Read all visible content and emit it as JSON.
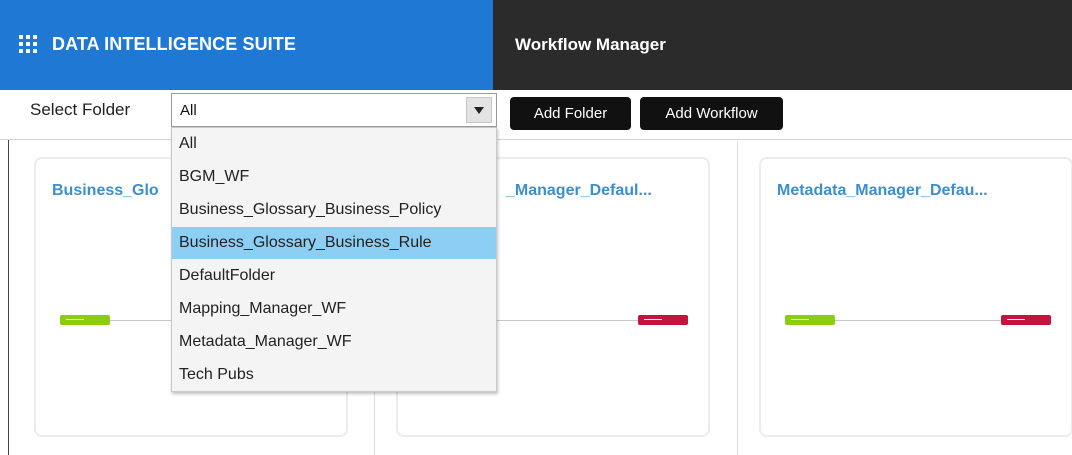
{
  "header": {
    "app_icon": "apps-grid-icon",
    "brand_title": "DATA INTELLIGENCE SUITE",
    "module_title": "Workflow Manager",
    "brand_color": "#1e78d4",
    "module_bar_color": "#2b2b2b"
  },
  "toolbar": {
    "select_folder_label": "Select Folder",
    "folder_select_value": "All",
    "add_folder_label": "Add Folder",
    "add_workflow_label": "Add Workflow"
  },
  "folder_dropdown": {
    "options": [
      "All",
      "BGM_WF",
      "Business_Glossary_Business_Policy",
      "Business_Glossary_Business_Rule",
      "DefaultFolder",
      "Mapping_Manager_WF",
      "Metadata_Manager_WF",
      "Tech Pubs"
    ],
    "highlighted_option": "Business_Glossary_Business_Rule",
    "highlight_color": "#8dcff4"
  },
  "workflow_cards": [
    {
      "title": "Business_Glo"
    },
    {
      "title": "_Manager_Defaul..."
    },
    {
      "title": "Metadata_Manager_Defau..."
    }
  ],
  "colors": {
    "card_title": "#3d8fcb",
    "start_node": "#8ccd10",
    "end_node": "#c2143d"
  }
}
